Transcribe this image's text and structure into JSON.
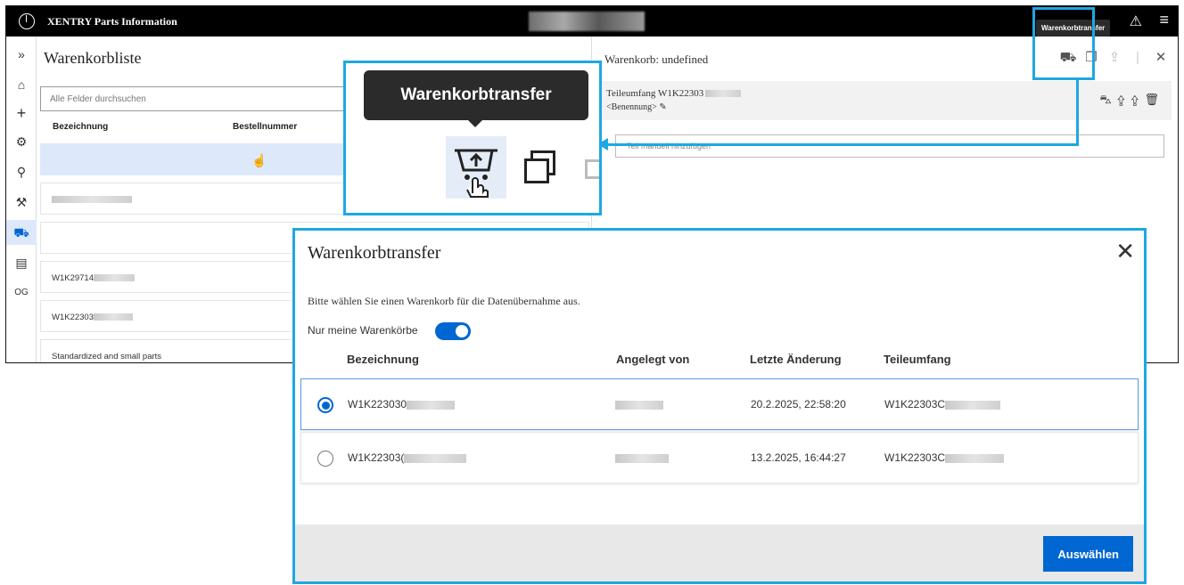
{
  "app": {
    "title": "XENTRY Parts Information",
    "icons": {
      "logo": "mercedes-star-icon",
      "warning": "warning-icon",
      "menu": "menu-icon"
    }
  },
  "left_rail": {
    "items": [
      {
        "icon": "expand-icon",
        "glyph": "»"
      },
      {
        "icon": "home-icon",
        "glyph": "⌂"
      },
      {
        "icon": "add-icon",
        "glyph": "+"
      },
      {
        "icon": "vehicle-parts-icon",
        "glyph": "⚙"
      },
      {
        "icon": "parts-search-icon",
        "glyph": "⚲"
      },
      {
        "icon": "wrench-icon",
        "glyph": "⚒"
      },
      {
        "icon": "cart-icon",
        "glyph": "⛟"
      },
      {
        "icon": "document-icon",
        "glyph": "▤"
      },
      {
        "label": "OG"
      }
    ]
  },
  "list_panel": {
    "title": "Warenkorbliste",
    "search_placeholder": "Alle Felder durchsuchen",
    "columns": [
      "Bezeichnung",
      "Bestellnummer"
    ],
    "rows": [
      {
        "label": ""
      },
      {
        "label": ""
      },
      {
        "label": ""
      },
      {
        "label": "W1K29714"
      },
      {
        "label": "W1K22303"
      },
      {
        "label": "Standardized and small parts"
      }
    ]
  },
  "cart_panel": {
    "title": "Warenkorb: undefined",
    "group_title": "Teileumfang W1K22303",
    "group_subtitle": "<Benennung>",
    "manual_input_placeholder": "Teil manuell hinzufügen"
  },
  "tooltip_small": "Warenkorbtransfer",
  "zoom_tooltip": "Warenkorbtransfer",
  "modal": {
    "title": "Warenkorbtransfer",
    "hint": "Bitte wählen Sie einen Warenkorb für die Datenübernahme aus.",
    "toggle_label": "Nur meine Warenkörbe",
    "toggle_on": true,
    "columns": {
      "name": "Bezeichnung",
      "created_by": "Angelegt von",
      "last_change": "Letzte Änderung",
      "scope": "Teileumfang"
    },
    "rows": [
      {
        "name": "W1K223030",
        "last_change": "20.2.2025, 22:58:20",
        "scope": "W1K22303C",
        "selected": true
      },
      {
        "name": "W1K22303(",
        "last_change": "13.2.2025, 16:44:27",
        "scope": "W1K22303C",
        "selected": false
      }
    ],
    "submit_label": "Auswählen"
  },
  "colors": {
    "accent": "#0067d2",
    "callout": "#1ea8e0",
    "header": "#000000"
  }
}
